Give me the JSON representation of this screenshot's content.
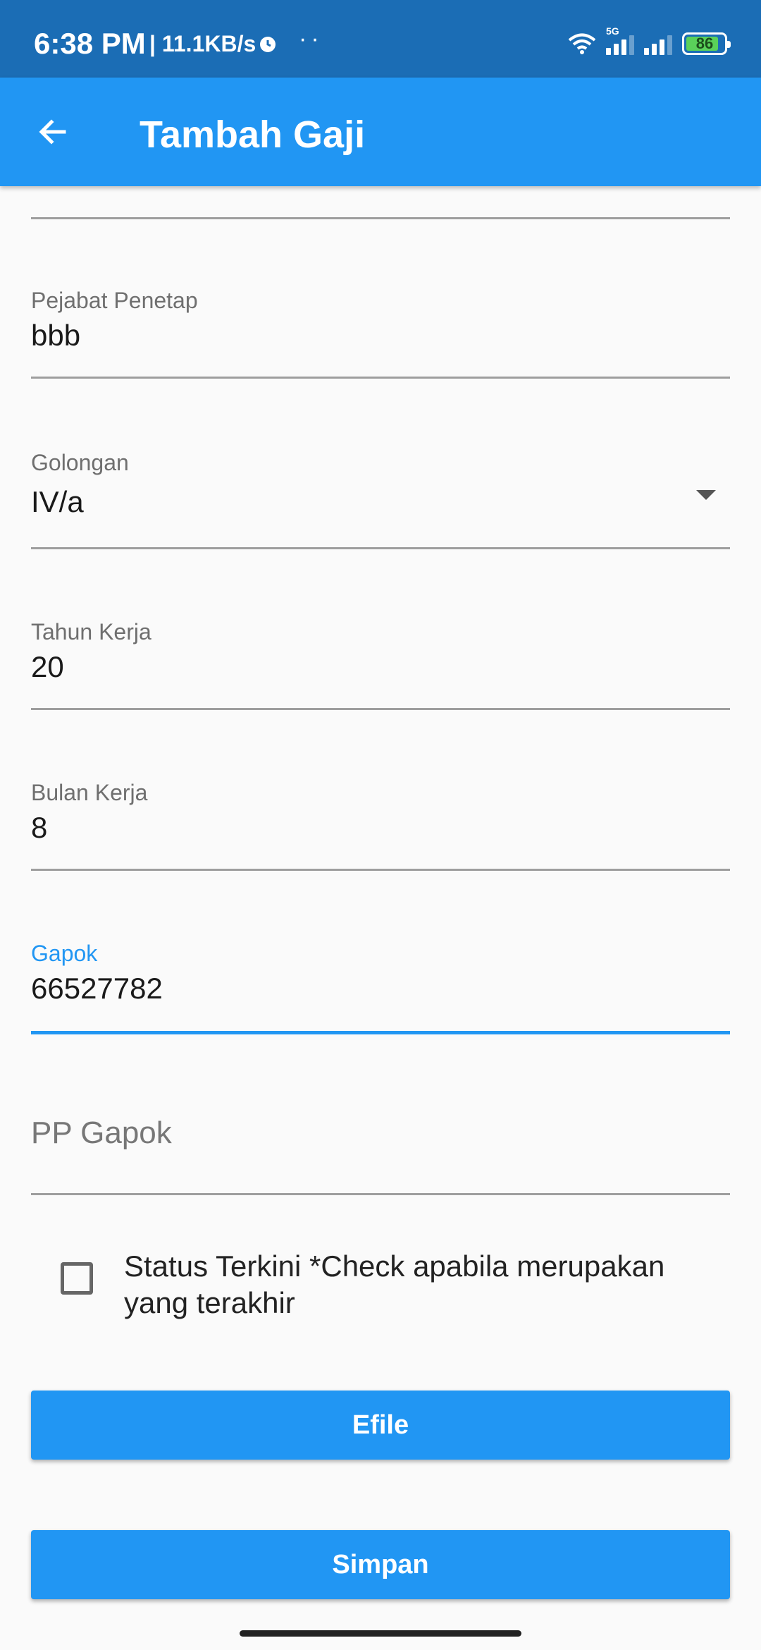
{
  "status_bar": {
    "time": "6:38 PM",
    "speed": "| 11.1KB/s",
    "dots": "··",
    "network": "5G",
    "battery": "86"
  },
  "app_bar": {
    "title": "Tambah Gaji",
    "back_icon": "arrow-left-icon"
  },
  "form": {
    "pejabat_penetap": {
      "label": "Pejabat Penetap",
      "value": "bbb"
    },
    "golongan": {
      "label": "Golongan",
      "value": "IV/a"
    },
    "tahun_kerja": {
      "label": "Tahun Kerja",
      "value": "20"
    },
    "bulan_kerja": {
      "label": "Bulan Kerja",
      "value": "8"
    },
    "gapok": {
      "label": "Gapok",
      "value": "66527782"
    },
    "pp_gapok": {
      "placeholder": "PP Gapok"
    },
    "status_terkini": {
      "label": "Status Terkini *Check apabila merupakan yang terakhir",
      "checked": false
    }
  },
  "buttons": {
    "efile": "Efile",
    "simpan": "Simpan"
  },
  "colors": {
    "status_bar": "#1b6db5",
    "primary": "#2196f3",
    "background": "#fafafa"
  }
}
